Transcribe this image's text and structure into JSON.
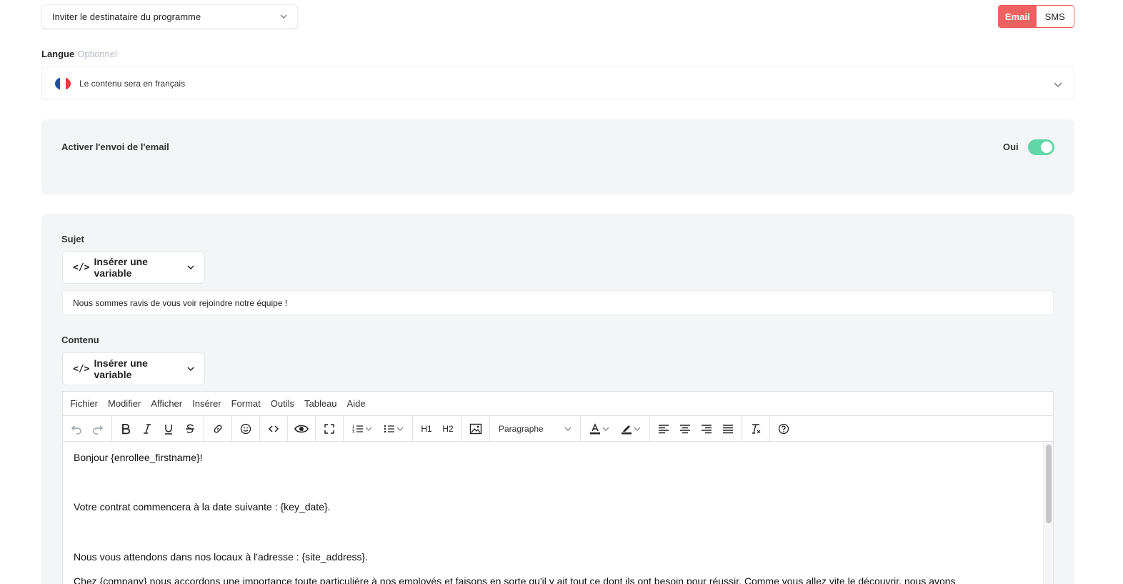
{
  "recipient_select": {
    "value": "Inviter le destinataire du programme"
  },
  "channel_toggle": {
    "email_label": "Email",
    "sms_label": "SMS",
    "active": "Email"
  },
  "language": {
    "label": "Langue",
    "optional_label": "Optionnel",
    "value": "Le contenu sera en français",
    "flag_colors": [
      "#1f4fa3",
      "#ffffff",
      "#e23b3b"
    ]
  },
  "email_activation": {
    "title": "Activer l'envoi de l'email",
    "status_label": "Oui",
    "enabled": true
  },
  "subject": {
    "label": "Sujet",
    "insert_variable_label": "Insérer une variable",
    "value": "Nous sommes ravis de vous voir rejoindre notre équipe !"
  },
  "content": {
    "label": "Contenu",
    "insert_variable_label": "Insérer une variable"
  },
  "editor": {
    "menu": [
      "Fichier",
      "Modifier",
      "Afficher",
      "Insérer",
      "Format",
      "Outils",
      "Tableau",
      "Aide"
    ],
    "toolbar": {
      "h1": "H1",
      "h2": "H2",
      "block_format": "Paragraphe"
    },
    "body_lines": [
      "Bonjour {enrollee_firstname}!",
      "Votre contrat commencera à la date suivante : {key_date}.",
      "Nous vous attendons dans nos locaux à l'adresse : {site_address}.",
      "Chez {company} nous accordons une importance toute particulière à nos employés et faisons en sorte qu'il y ait tout ce dont ils ont besoin pour réussir. Comme vous allez vite le découvrir, nous avons"
    ]
  },
  "colors": {
    "accent": "#f16060",
    "toggle_on": "#5fd8a7",
    "panel_bg": "#f4f5f6"
  }
}
